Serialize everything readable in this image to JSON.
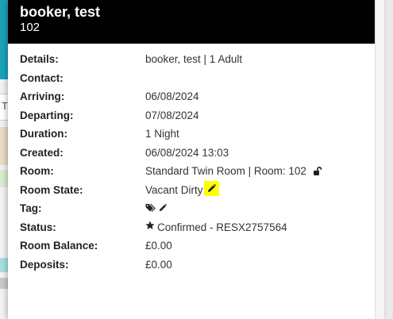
{
  "background": {
    "partial_text": "T"
  },
  "header": {
    "guest_name": "booker, test",
    "room_number": "102"
  },
  "details": [
    {
      "label": "Details:",
      "value": "booker, test | 1 Adult"
    },
    {
      "label": "Contact:",
      "value": ""
    },
    {
      "label": "Arriving:",
      "value": "06/08/2024"
    },
    {
      "label": "Departing:",
      "value": "07/08/2024"
    },
    {
      "label": "Duration:",
      "value": "1 Night"
    },
    {
      "label": "Created:",
      "value": "06/08/2024 13:03"
    },
    {
      "label": "Room:",
      "value": "Standard Twin Room | Room: 102"
    },
    {
      "label": "Room State:",
      "value": "Vacant Dirty"
    },
    {
      "label": "Tag:",
      "value": ""
    },
    {
      "label": "Status:",
      "value": "Confirmed - RESX2757564"
    },
    {
      "label": "Room Balance:",
      "value": "£0.00"
    },
    {
      "label": "Deposits:",
      "value": "£0.00"
    }
  ],
  "icons": {
    "room": "unlock-icon",
    "room_state_edit": "pencil-icon",
    "tag": [
      "tags-icon",
      "pencil-icon"
    ],
    "status": "star-icon"
  },
  "colors": {
    "header_bg": "#000000",
    "highlight": "#ffff00",
    "accent_bg": "#1aa3b8"
  }
}
